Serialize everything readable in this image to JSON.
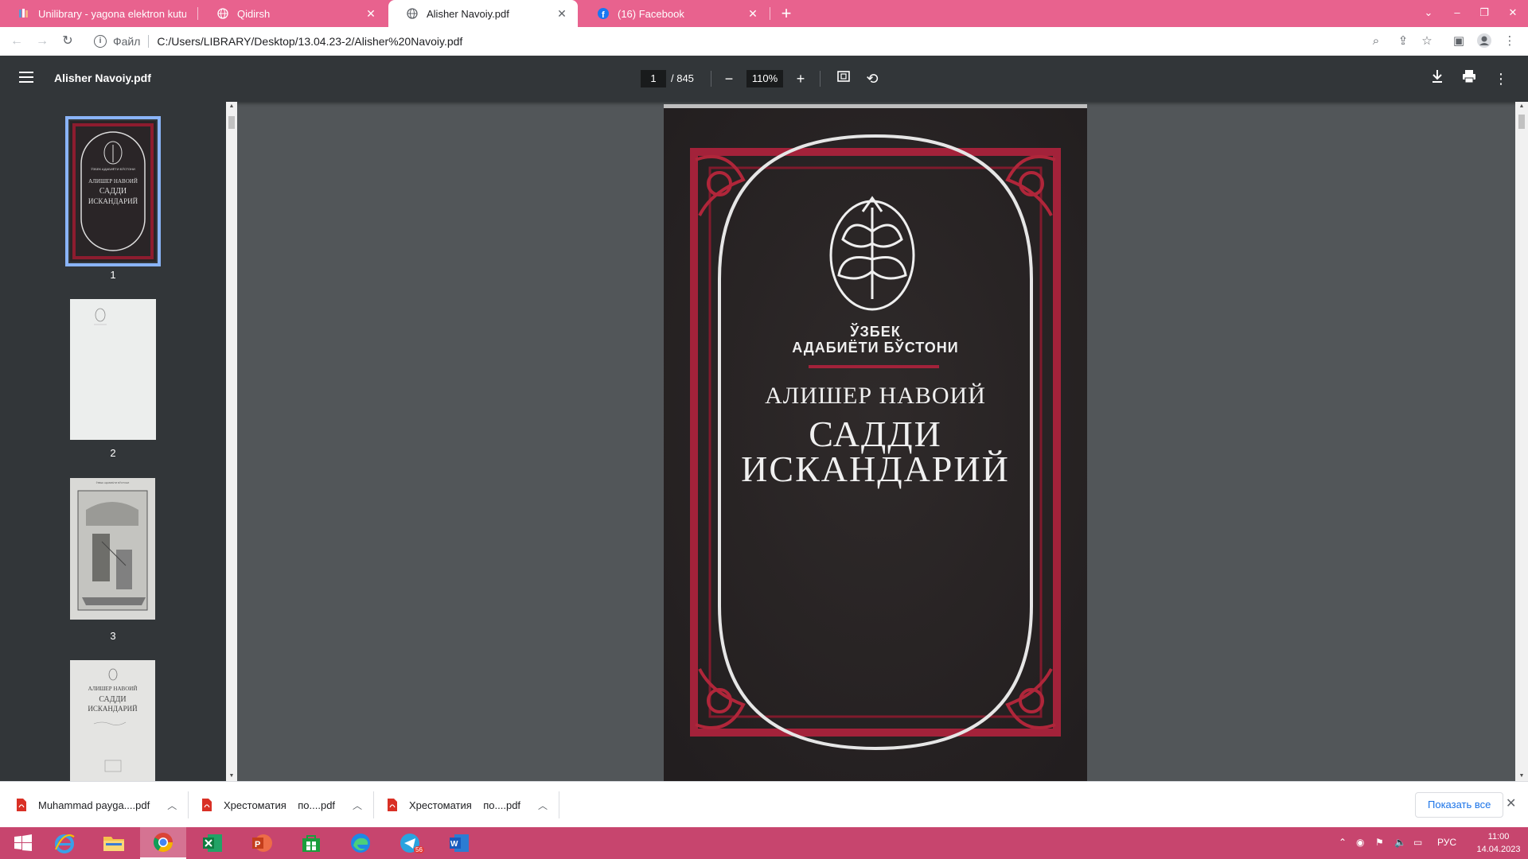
{
  "browser": {
    "tabs": [
      {
        "title": "Unilibrary - yagona elektron kutubxona",
        "active": false,
        "icon": "unilibrary-icon"
      },
      {
        "title": "Qidirsh",
        "active": false,
        "icon": "globe-icon"
      },
      {
        "title": "Alisher Navoiy.pdf",
        "active": true,
        "icon": "globe-icon"
      },
      {
        "title": "(16) Facebook",
        "active": false,
        "icon": "facebook-icon"
      }
    ],
    "close_glyph": "✕",
    "new_tab_glyph": "+",
    "scheme_label": "Файл",
    "url": "C:/Users/LIBRARY/Desktop/13.04.23-2/Alisher%20Navoiy.pdf"
  },
  "pdf_viewer": {
    "title": "Alisher Navoiy.pdf",
    "current_page": "1",
    "total_pages": "/ 845",
    "zoom": "110%"
  },
  "thumbnails": [
    {
      "number": "1",
      "selected": true
    },
    {
      "number": "2",
      "selected": false
    },
    {
      "number": "3",
      "selected": false
    },
    {
      "number": "4",
      "selected": false
    }
  ],
  "thumbnail_text": {
    "cover_series": "ЎЗБЕК АДАБИЁТИ БЎСТОНИ",
    "author": "АЛИШЕР НАВОИЙ",
    "title_line1": "САДДИ",
    "title_line2": "ИСКАНДАРИЙ",
    "page3_header": "ЎЗБЕК АДАБИЁТИ БЎСТОНИ"
  },
  "cover": {
    "series_line1": "ЎЗБЕК",
    "series_line2": "АДАБИЁТИ БЎСТОНИ",
    "author": "АЛИШЕР НАВОИЙ",
    "title_line1": "САДДИ",
    "title_line2": "ИСКАНДАРИЙ"
  },
  "downloads": [
    {
      "name": "Muhammad payga....pdf"
    },
    {
      "name": "Хрестоматия    по....pdf"
    },
    {
      "name": "Хрестоматия    по....pdf"
    }
  ],
  "show_all_label": "Показать все",
  "taskbar": {
    "telegram_badge": "56",
    "language": "РУС",
    "time": "11:00",
    "date": "14.04.2023"
  },
  "colors": {
    "tabstrip": "#e8628e",
    "taskbar": "#c7456e",
    "pdf_toolbar": "#323639",
    "viewer_bg": "#525659",
    "cover_frame_red": "#b0263a"
  }
}
